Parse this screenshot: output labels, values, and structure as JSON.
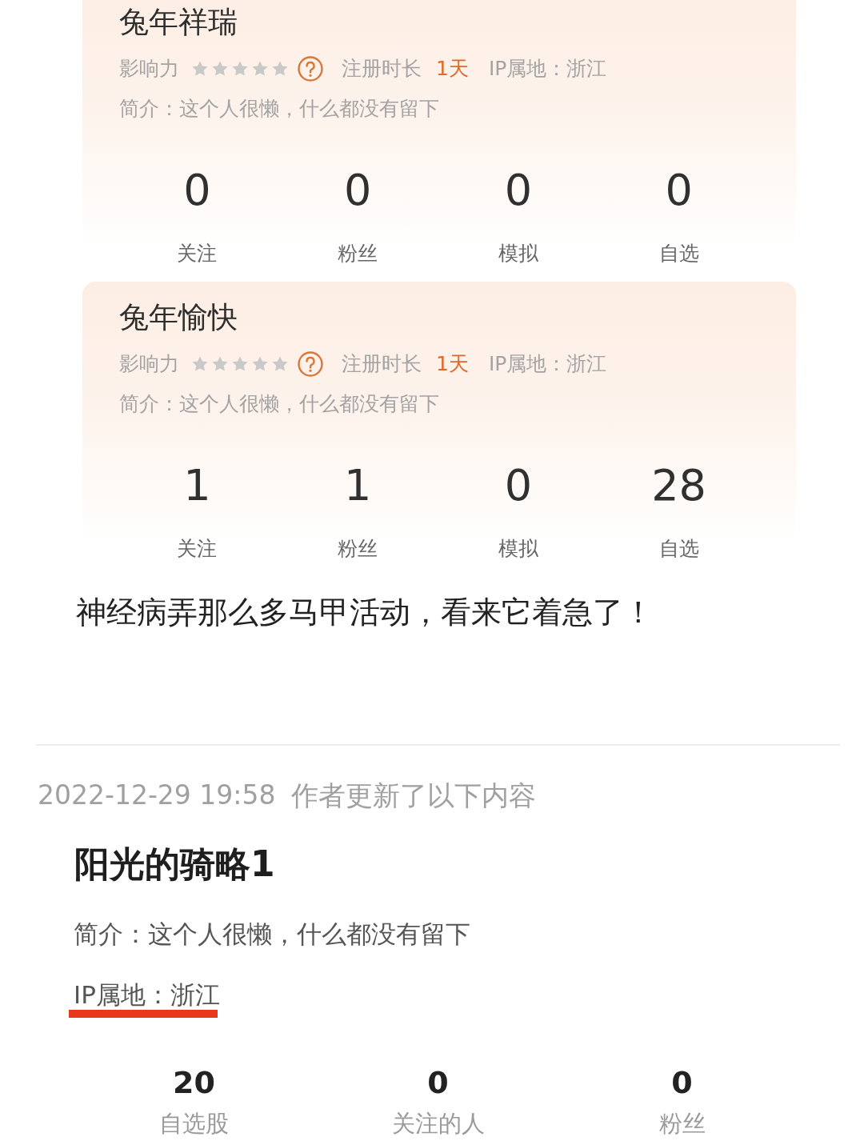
{
  "cards": [
    {
      "name": "兔年祥瑞",
      "influence_label": "影响力",
      "stars": 0,
      "register_label": "注册时长",
      "register_value": "1天",
      "ip": "IP属地：浙江",
      "intro": "简介：这个人很懒，什么都没有留下",
      "stats": [
        {
          "value": "0",
          "label": "关注"
        },
        {
          "value": "0",
          "label": "粉丝"
        },
        {
          "value": "0",
          "label": "模拟"
        },
        {
          "value": "0",
          "label": "自选"
        }
      ]
    },
    {
      "name": "兔年愉快",
      "influence_label": "影响力",
      "stars": 0,
      "register_label": "注册时长",
      "register_value": "1天",
      "ip": "IP属地：浙江",
      "intro": "简介：这个人很懒，什么都没有留下",
      "stats": [
        {
          "value": "1",
          "label": "关注"
        },
        {
          "value": "1",
          "label": "粉丝"
        },
        {
          "value": "0",
          "label": "模拟"
        },
        {
          "value": "28",
          "label": "自选"
        }
      ]
    }
  ],
  "comment": "神经病弄那么多马甲活动，看来它着急了！",
  "update": {
    "time": "2022-12-29 19:58",
    "text": "作者更新了以下内容"
  },
  "profile": {
    "name": "阳光的骑略1",
    "intro": "简介：这个人很懒，什么都没有留下",
    "ip": "IP属地：浙江",
    "ip_underlined": true,
    "stats": [
      {
        "value": "20",
        "label": "自选股"
      },
      {
        "value": "0",
        "label": "关注的人"
      },
      {
        "value": "0",
        "label": "粉丝"
      }
    ]
  }
}
